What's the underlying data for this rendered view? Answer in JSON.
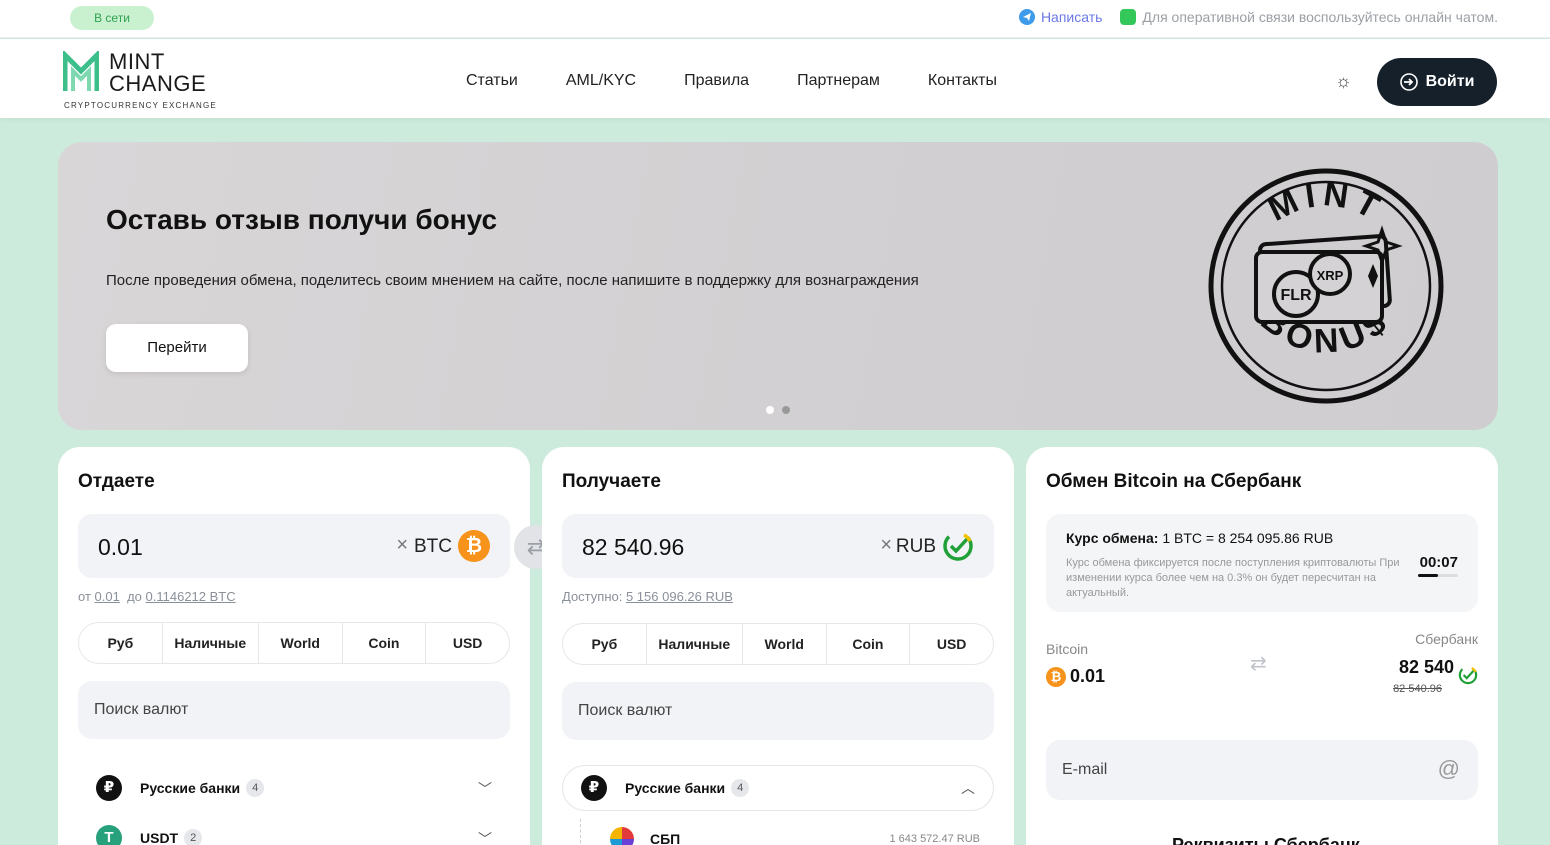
{
  "topbar": {
    "online_badge": "В сети",
    "write_link": "Написать",
    "chat_note": "Для оперативной связи воспользуйтесь онлайн чатом."
  },
  "header": {
    "logo_line1": "MINT",
    "logo_line2": "CHANGE",
    "logo_sub": "CRYPTOCURRENCY EXCHANGE",
    "nav": [
      "Статьи",
      "AML/KYC",
      "Правила",
      "Партнерам",
      "Контакты"
    ],
    "login_label": "Войти"
  },
  "banner": {
    "title": "Оставь отзыв получи бонус",
    "text": "После проведения обмена, поделитесь своим мнением на сайте, после напишите в поддержку для вознаграждения",
    "button": "Перейти",
    "stamp_top": "MINT",
    "stamp_bottom": "BONU$",
    "coin1": "FLR",
    "coin2": "XRP",
    "slides_total": 2,
    "slide_active": 1
  },
  "give": {
    "title": "Отдаете",
    "amount": "0.01",
    "clear": "×",
    "currency": "BTC",
    "limits_from_label": "от",
    "limits_from": "0.01",
    "limits_to_label": "до",
    "limits_to": "0.1146212 BTC",
    "tabs": [
      "Руб",
      "Наличные",
      "World",
      "Coin",
      "USD"
    ],
    "search_placeholder": "Поиск валют",
    "groups": [
      {
        "label": "Русские банки",
        "count": "4",
        "icon": "₽"
      },
      {
        "label": "USDT",
        "count": "2",
        "icon": "T"
      }
    ]
  },
  "get": {
    "title": "Получаете",
    "amount": "82 540.96",
    "clear": "×",
    "currency": "RUB",
    "available_label": "Доступно:",
    "available": "5 156 096.26 RUB",
    "tabs": [
      "Руб",
      "Наличные",
      "World",
      "Coin",
      "USD"
    ],
    "search_placeholder": "Поиск валют",
    "group": {
      "label": "Русские банки",
      "count": "4",
      "icon": "₽"
    },
    "sub_item": {
      "label": "СБП",
      "amount": "1 643 572.47 RUB"
    }
  },
  "info": {
    "title": "Обмен Bitcoin на Сбербанк",
    "rate_label": "Курс обмена:",
    "rate_value": "1 BTC = 8 254 095.86 RUB",
    "rate_note": "Курс обмена фиксируется после поступления криптовалюты При изменении курса более чем на 0.3% он будет пересчитан на актуальный.",
    "timer": "00:07",
    "timer_progress": 0.5,
    "from_name": "Bitcoin",
    "from_value": "0.01",
    "to_name": "Сбербанк",
    "to_value": "82 540",
    "to_old": "82 540.96",
    "email_placeholder": "E-mail",
    "requisites_title": "Реквизиты Сбербанк"
  },
  "colors": {
    "accent_dark": "#15202b",
    "online_green": "#2ea44f",
    "btc_orange": "#f7931a",
    "page_bg": "#cdebdc"
  }
}
